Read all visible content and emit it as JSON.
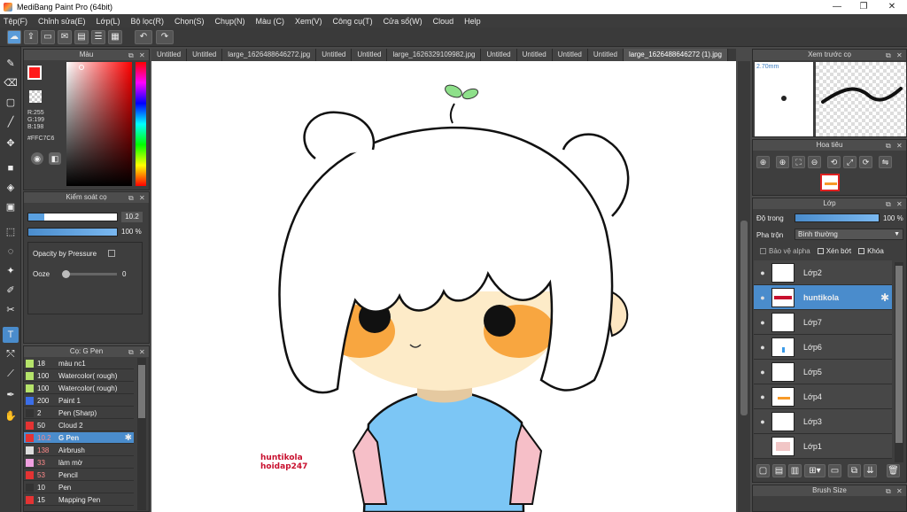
{
  "window": {
    "title": "MediBang Paint Pro (64bit)"
  },
  "menu": [
    "Tệp(F)",
    "Chỉnh sửa(E)",
    "Lớp(L)",
    "Bộ lọc(R)",
    "Chọn(S)",
    "Chụp(N)",
    "Màu (C)",
    "Xem(V)",
    "Công cụ(T)",
    "Cửa sổ(W)",
    "Cloud",
    "Help"
  ],
  "tabs": [
    "Untitled",
    "Untitled",
    "large_1626488646272.jpg",
    "Untitled",
    "Untitled",
    "large_1626329109982.jpg",
    "Untitled",
    "Untitled",
    "Untitled",
    "Untitled",
    "large_1626488646272 (1).jpg"
  ],
  "color_panel": {
    "title": "Màu",
    "r": "R:255",
    "g": "G:199",
    "b": "B:198",
    "hex": "#FFC7C6",
    "fg_color": "#ff1a1a",
    "accent": "#4a8ccc"
  },
  "brush_control": {
    "title": "Kiểm soát cọ",
    "size": "10.2",
    "opacity": "100 %",
    "opacity_pressure": "Opacity by Pressure",
    "ooze_label": "Ooze",
    "ooze_value": "0"
  },
  "brush_list": {
    "title": "Cọ: G Pen",
    "items": [
      {
        "size": "18",
        "name": "màu nc1",
        "color": "#b5e36a"
      },
      {
        "size": "100",
        "name": "Watercolor( rough)",
        "color": "#b5e36a"
      },
      {
        "size": "100",
        "name": "Watercolor( rough)",
        "color": "#b5e36a"
      },
      {
        "size": "200",
        "name": "Paint 1",
        "color": "#3b6ee8"
      },
      {
        "size": "2",
        "name": "Pen (Sharp)",
        "color": "#333333"
      },
      {
        "size": "50",
        "name": "Cloud 2",
        "color": "#e43333"
      },
      {
        "size": "10.2",
        "name": "G Pen",
        "color": "#e43333"
      },
      {
        "size": "138",
        "name": "Airbrush",
        "color": "#dddddd"
      },
      {
        "size": "33",
        "name": "làm mờ",
        "color": "#f0a0e0"
      },
      {
        "size": "53",
        "name": "Pencil",
        "color": "#e43333"
      },
      {
        "size": "10",
        "name": "Pen",
        "color": "#333333"
      },
      {
        "size": "15",
        "name": "Mapping Pen",
        "color": "#e43333"
      }
    ]
  },
  "preview": {
    "title": "Xem trước cọ",
    "size": "2.70mm"
  },
  "navigator": {
    "title": "Hoa tiêu"
  },
  "layer_panel": {
    "title": "Lớp",
    "opacity_label": "Độ trong",
    "opacity_value": "100 %",
    "blend_label": "Pha trộn",
    "blend_value": "Bình thường",
    "alpha_label": "Bảo vệ alpha",
    "clip_label": "Xén bớt",
    "lock_label": "Khóa",
    "layers": [
      "Lớp2",
      "huntikola",
      "Lớp7",
      "Lớp6",
      "Lớp5",
      "Lớp4",
      "Lớp3",
      "Lớp1"
    ]
  },
  "brush_size_panel": {
    "title": "Brush Size"
  },
  "canvas": {
    "watermark_line1": "huntikola",
    "watermark_line2": "hoidap247"
  }
}
